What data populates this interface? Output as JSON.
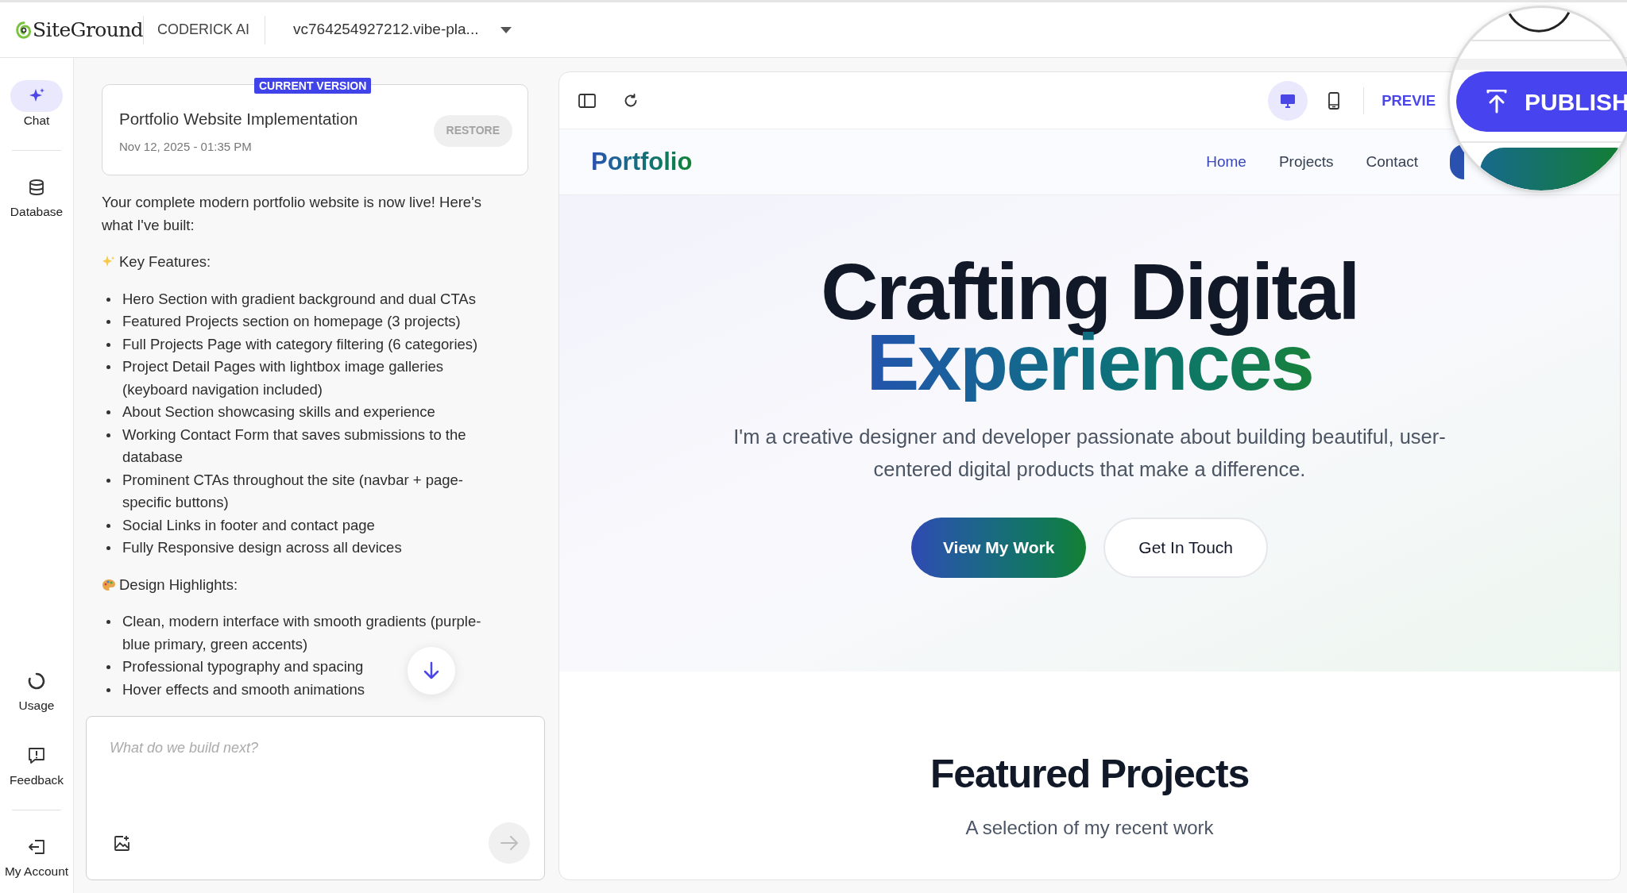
{
  "top_bar": {
    "logo": "SiteGround",
    "product": "CODERICK AI",
    "project": "vc764254927212.vibe-pla..."
  },
  "nav_rail": {
    "top": [
      {
        "label": "Chat",
        "kind": "chat",
        "selected": true
      },
      {
        "label": "Database",
        "kind": "database",
        "selected": false
      }
    ],
    "bottom": [
      {
        "label": "Usage",
        "kind": "usage",
        "selected": false
      },
      {
        "label": "Feedback",
        "kind": "feedback",
        "selected": false
      },
      {
        "label": "My Account",
        "kind": "account",
        "selected": false
      }
    ]
  },
  "version_card": {
    "badge": "CURRENT VERSION",
    "title": "Portfolio Website Implementation",
    "date": "Nov 12, 2025 - 01:35 PM",
    "restore": "RESTORE",
    "restore_disabled": true
  },
  "message": [
    {
      "kind": "paragraph",
      "text": "Your complete modern portfolio website is now live! Here's what I've built:"
    },
    {
      "kind": "heading",
      "text": "Key Features:"
    },
    {
      "kind": "list",
      "items": [
        "Hero Section with gradient background and dual CTAs",
        "Featured Projects section on homepage (3 projects)",
        "Full Projects Page with category filtering (6 categories)",
        "Project Detail Pages with lightbox image galleries (keyboard navigation included)",
        "About Section showcasing skills and experience",
        "Working Contact Form that saves submissions to the database",
        "Prominent CTAs throughout the site (navbar + page-specific buttons)",
        "Social Links in footer and contact page",
        "Fully Responsive design across all devices"
      ]
    },
    {
      "kind": "heading",
      "text": "Design Highlights:"
    },
    {
      "kind": "list",
      "items": [
        "Clean, modern interface with smooth gradients (purple-blue primary, green accents)",
        "Professional typography and spacing",
        "Hover effects and smooth animations"
      ]
    }
  ],
  "composer": {
    "placeholder": "What do we build next?",
    "send_disabled": true
  },
  "preview": {
    "devices": [
      {
        "kind": "desktop",
        "selected": true
      },
      {
        "kind": "mobile",
        "selected": false
      }
    ],
    "preview_label": "PREVIE",
    "publish": "PUBLISH",
    "site": {
      "logo": "Portfolio",
      "nav": [
        {
          "label": "Home",
          "selected": true
        },
        {
          "label": "Projects",
          "selected": false
        },
        {
          "label": "Contact",
          "selected": false
        }
      ],
      "hero": {
        "title": "Crafting Digital",
        "title_accent": "Experiences",
        "subtitle": "I'm a creative designer and developer passionate about building beautiful, user-centered digital products that make a difference.",
        "buttons": [
          {
            "label": "View My Work",
            "kind": "primary"
          },
          {
            "label": "Get In Touch",
            "kind": "secondary"
          }
        ]
      },
      "featured": {
        "title": "Featured Projects",
        "subtitle": "A selection of my recent work"
      }
    }
  }
}
